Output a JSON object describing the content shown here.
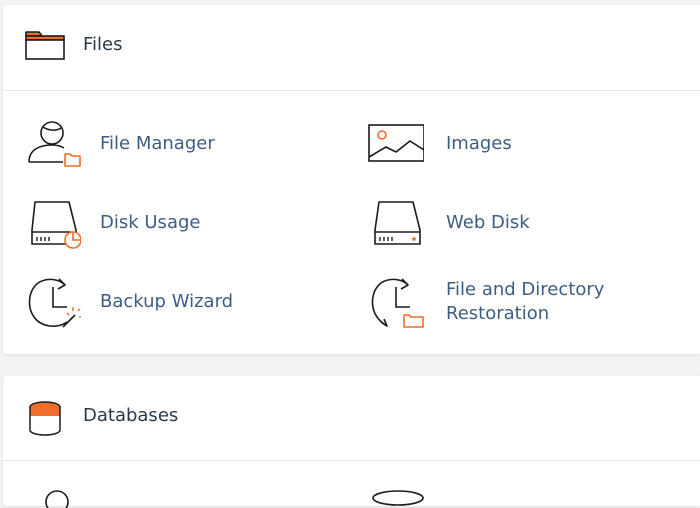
{
  "files": {
    "title": "Files",
    "tools": [
      {
        "label": "File Manager"
      },
      {
        "label": "Images"
      },
      {
        "label": "Disk Usage"
      },
      {
        "label": "Web Disk"
      },
      {
        "label": "Backup Wizard"
      },
      {
        "label_line1": "File and Directory",
        "label_line2": "Restoration"
      }
    ]
  },
  "databases": {
    "title": "Databases"
  },
  "colors": {
    "accent": "#f26c2b",
    "link": "#3d5d84",
    "heading": "#293a4a",
    "icon_stroke": "#1b1b1b"
  }
}
